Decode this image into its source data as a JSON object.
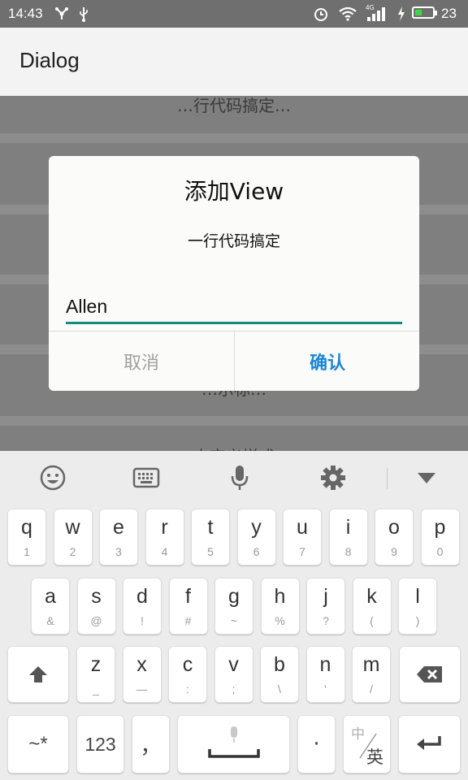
{
  "status_bar": {
    "time": "14:43",
    "network": "4G",
    "battery_level": "23",
    "battery_color": "#3fd63f"
  },
  "app_bar": {
    "title": "Dialog"
  },
  "background": {
    "fragment_top": "…行代码搞定…",
    "fragment_middle": "…示标…",
    "fragment_bottom": "…自定义样式…"
  },
  "dialog": {
    "title": "添加View",
    "message": "一行代码搞定",
    "input_value": "Allen",
    "cancel_label": "取消",
    "confirm_label": "确认",
    "accent_color": "#168a7c",
    "confirm_color": "#1a85d6"
  },
  "keyboard": {
    "toolbar": [
      "emoji-icon",
      "keyboard-icon",
      "microphone-icon",
      "gear-icon",
      "collapse-icon"
    ],
    "row1": [
      {
        "k": "q",
        "n": "1"
      },
      {
        "k": "w",
        "n": "2"
      },
      {
        "k": "e",
        "n": "3"
      },
      {
        "k": "r",
        "n": "4"
      },
      {
        "k": "t",
        "n": "5"
      },
      {
        "k": "y",
        "n": "6"
      },
      {
        "k": "u",
        "n": "7"
      },
      {
        "k": "i",
        "n": "8"
      },
      {
        "k": "o",
        "n": "9"
      },
      {
        "k": "p",
        "n": "0"
      }
    ],
    "row2": [
      {
        "k": "a",
        "n": "&"
      },
      {
        "k": "s",
        "n": "@"
      },
      {
        "k": "d",
        "n": "!"
      },
      {
        "k": "f",
        "n": "#"
      },
      {
        "k": "g",
        "n": "~"
      },
      {
        "k": "h",
        "n": "%"
      },
      {
        "k": "j",
        "n": "?"
      },
      {
        "k": "k",
        "n": "("
      },
      {
        "k": "l",
        "n": ")"
      }
    ],
    "row3": [
      {
        "k": "z",
        "n": "_"
      },
      {
        "k": "x",
        "n": "—"
      },
      {
        "k": "c",
        "n": ":"
      },
      {
        "k": "v",
        "n": ";"
      },
      {
        "k": "b",
        "n": "\\"
      },
      {
        "k": "n",
        "n": "'"
      },
      {
        "k": "m",
        "n": "/"
      }
    ],
    "symbols_label": "~*",
    "numbers_label": "123",
    "comma_label": "，",
    "period_label": "·",
    "lang_top": "中",
    "lang_bottom": "英"
  }
}
